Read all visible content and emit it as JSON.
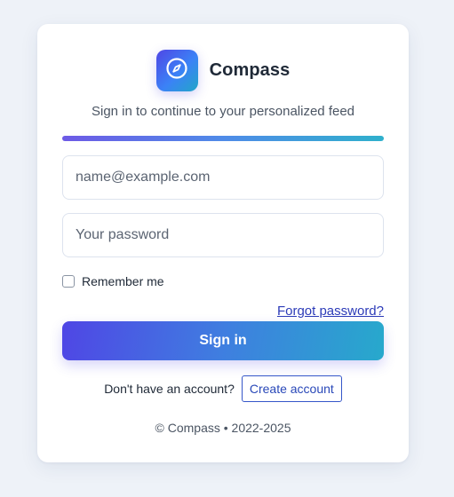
{
  "brand": {
    "name": "Compass",
    "logo_icon": "compass-icon",
    "accent_start": "#4f46e5",
    "accent_end": "#22a6c8"
  },
  "subtitle": "Sign in to continue to your personalized feed",
  "form": {
    "email_placeholder": "name@example.com",
    "email_value": "",
    "password_placeholder": "Your password",
    "password_value": "",
    "remember_label": "Remember me",
    "remember_checked": false,
    "forgot_label": "Forgot password?",
    "signin_label": "Sign in"
  },
  "signup": {
    "prompt": "Don't have an account?",
    "button_label": "Create account"
  },
  "footer": "© Compass • 2022-2025"
}
